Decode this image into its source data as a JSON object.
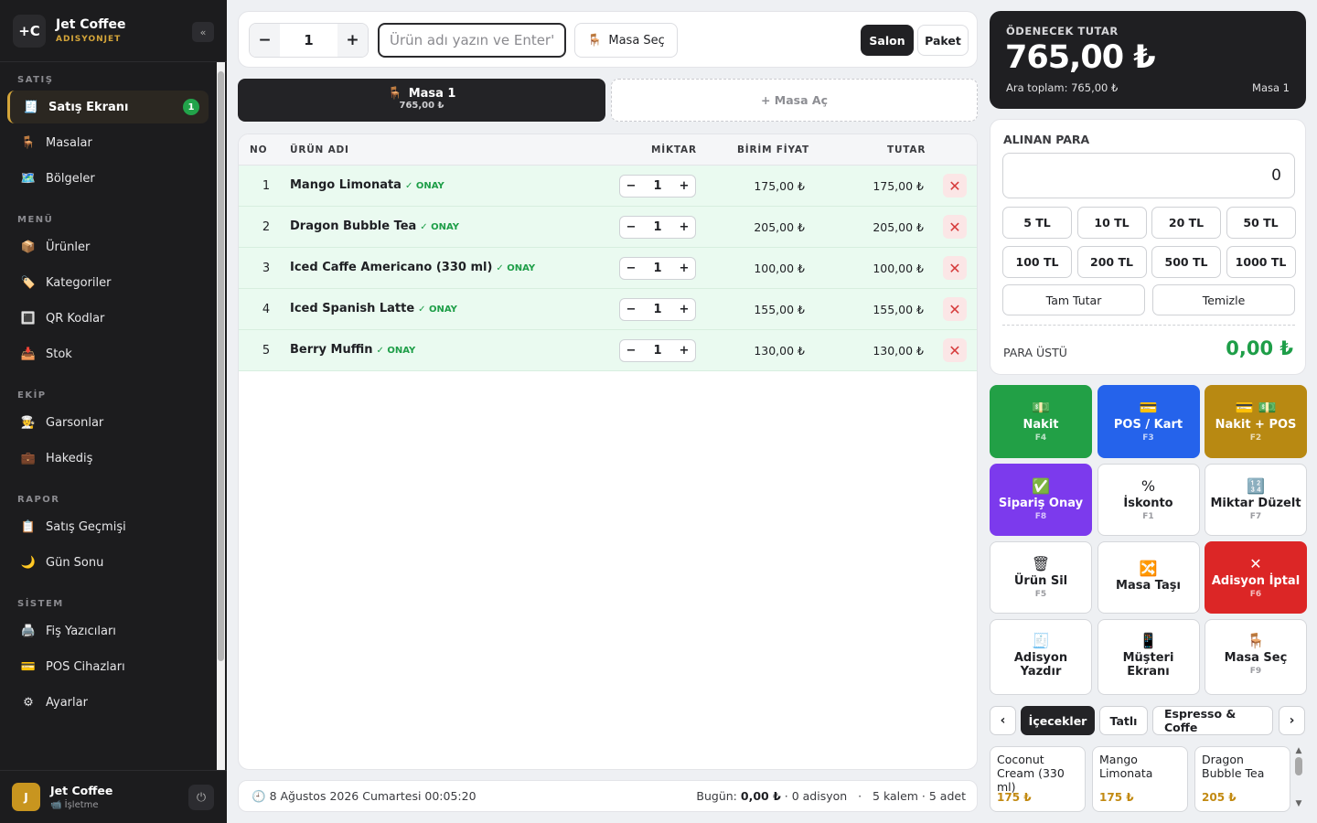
{
  "brand": {
    "logo": "+C",
    "name": "Jet Coffee",
    "sub": "ADISYONJET",
    "collapse": "«"
  },
  "nav": {
    "sections": [
      {
        "title": "SATIŞ",
        "items": [
          {
            "label": "Satış Ekranı",
            "icon": "🧾",
            "icon_name": "receipt-icon",
            "active": true,
            "badge": "1"
          },
          {
            "label": "Masalar",
            "icon": "🪑",
            "icon_name": "chair-icon"
          },
          {
            "label": "Bölgeler",
            "icon": "🗺️",
            "icon_name": "map-icon"
          }
        ]
      },
      {
        "title": "MENÜ",
        "items": [
          {
            "label": "Ürünler",
            "icon": "📦",
            "icon_name": "box-icon"
          },
          {
            "label": "Kategoriler",
            "icon": "🏷️",
            "icon_name": "tag-icon"
          },
          {
            "label": "QR Kodlar",
            "icon": "🔳",
            "icon_name": "qr-icon"
          },
          {
            "label": "Stok",
            "icon": "📥",
            "icon_name": "inbox-icon"
          }
        ]
      },
      {
        "title": "EKİP",
        "items": [
          {
            "label": "Garsonlar",
            "icon": "🧑‍🍳",
            "icon_name": "waiter-icon"
          },
          {
            "label": "Hakediş",
            "icon": "💼",
            "icon_name": "briefcase-icon"
          }
        ]
      },
      {
        "title": "RAPOR",
        "items": [
          {
            "label": "Satış Geçmişi",
            "icon": "📋",
            "icon_name": "clipboard-icon"
          },
          {
            "label": "Gün Sonu",
            "icon": "🌙",
            "icon_name": "moon-icon"
          }
        ]
      },
      {
        "title": "SİSTEM",
        "items": [
          {
            "label": "Fiş Yazıcıları",
            "icon": "🖨️",
            "icon_name": "printer-icon"
          },
          {
            "label": "POS Cihazları",
            "icon": "💳",
            "icon_name": "card-icon"
          },
          {
            "label": "Ayarlar",
            "icon": "⚙",
            "icon_name": "gear-icon"
          }
        ]
      }
    ]
  },
  "user": {
    "initial": "J",
    "name": "Jet Coffee",
    "role": "📹 İşletme",
    "power": "⏻"
  },
  "topbar": {
    "minus": "−",
    "qty": "1",
    "plus": "+",
    "search_placeholder": "Ürün adı yazın ve Enter'a basın",
    "masa_sec": "Masa Seç",
    "masa_icon": "🪑",
    "salon": "Salon",
    "paket": "Paket"
  },
  "tabs": {
    "active": {
      "icon": "🪑",
      "label": "Masa 1",
      "amount": "765,00 ₺"
    },
    "new_label": "+  Masa Aç"
  },
  "table": {
    "headers": {
      "no": "NO",
      "name": "ÜRÜN ADI",
      "qty": "MİKTAR",
      "price": "BİRİM FİYAT",
      "total": "TUTAR"
    },
    "rows": [
      {
        "no": "1",
        "name": "Mango Limonata",
        "status": "✓ ONAY",
        "qty": "1",
        "price": "175,00 ₺",
        "total": "175,00 ₺"
      },
      {
        "no": "2",
        "name": "Dragon Bubble Tea",
        "status": "✓ ONAY",
        "qty": "1",
        "price": "205,00 ₺",
        "total": "205,00 ₺"
      },
      {
        "no": "3",
        "name": "Iced Caffe Americano (330 ml)",
        "status": "✓ ONAY",
        "qty": "1",
        "price": "100,00 ₺",
        "total": "100,00 ₺"
      },
      {
        "no": "4",
        "name": "Iced Spanish Latte",
        "status": "✓ ONAY",
        "qty": "1",
        "price": "155,00 ₺",
        "total": "155,00 ₺"
      },
      {
        "no": "5",
        "name": "Berry Muffin",
        "status": "✓ ONAY",
        "qty": "1",
        "price": "130,00 ₺",
        "total": "130,00 ₺"
      }
    ],
    "minus": "−",
    "plus": "+",
    "delete": "✕"
  },
  "footer": {
    "clock_icon": "🕘",
    "datetime": "8 Ağustos 2026 Cumartesi 00:05:20",
    "today_label": "Bugün:",
    "today_amount": "0,00 ₺",
    "today_count": "· 0 adisyon",
    "sep": "·",
    "summary": "5 kalem · 5 adet"
  },
  "total": {
    "label": "ÖDENECEK TUTAR",
    "amount": "765,00 ₺",
    "subtotal": "Ara toplam: 765,00 ₺",
    "masa": "Masa 1"
  },
  "payment": {
    "label": "ALINAN PARA",
    "value": "0",
    "quick": [
      "5 TL",
      "10 TL",
      "20 TL",
      "50 TL",
      "100 TL",
      "200 TL",
      "500 TL",
      "1000 TL"
    ],
    "exact": "Tam Tutar",
    "clear": "Temizle",
    "change_label": "PARA ÜSTÜ",
    "change_value": "0,00 ₺"
  },
  "actions": [
    {
      "icon": "💵",
      "label": "Nakit",
      "key": "F4",
      "style": "green",
      "name": "cash-button"
    },
    {
      "icon": "💳",
      "label": "POS / Kart",
      "key": "F3",
      "style": "blue",
      "name": "pos-card-button"
    },
    {
      "icon": "💳 💵",
      "label": "Nakit + POS",
      "key": "F2",
      "style": "gold",
      "name": "cash-pos-button"
    },
    {
      "icon": "✅",
      "label": "Sipariş Onay",
      "key": "F8",
      "style": "purple",
      "name": "order-confirm-button"
    },
    {
      "icon": "%",
      "label": "İskonto",
      "key": "F1",
      "style": "",
      "name": "discount-button"
    },
    {
      "icon": "🔢",
      "label": "Miktar Düzelt",
      "key": "F7",
      "style": "",
      "name": "edit-quantity-button"
    },
    {
      "icon": "🗑",
      "label": "Ürün Sil",
      "key": "F5",
      "style": "",
      "name": "delete-product-button"
    },
    {
      "icon": "🔀",
      "label": "Masa Taşı",
      "key": "",
      "style": "",
      "name": "move-table-button"
    },
    {
      "icon": "✕",
      "label": "Adisyon İptal",
      "key": "F6",
      "style": "red",
      "name": "cancel-bill-button"
    },
    {
      "icon": "🧾",
      "label": "Adisyon Yazdır",
      "key": "",
      "style": "",
      "name": "print-bill-button"
    },
    {
      "icon": "📱",
      "label": "Müşteri Ekranı",
      "key": "",
      "style": "",
      "name": "customer-screen-button"
    },
    {
      "icon": "🪑",
      "label": "Masa Seç",
      "key": "F9",
      "style": "",
      "name": "select-table-button"
    }
  ],
  "categories": {
    "prev": "‹",
    "next": "›",
    "items": [
      "İçecekler",
      "Tatlı",
      "Espresso & Coffe"
    ],
    "selected": 0
  },
  "products": [
    {
      "name": "Coconut Cream (330 ml)",
      "price": "175 ₺"
    },
    {
      "name": "Mango Limonata",
      "price": "175 ₺"
    },
    {
      "name": "Dragon Bubble Tea",
      "price": "205 ₺"
    }
  ],
  "colors": {
    "accent": "#d4a53a",
    "dark": "#1f1f22",
    "success": "#1e9e48",
    "danger": "#dc2626"
  }
}
